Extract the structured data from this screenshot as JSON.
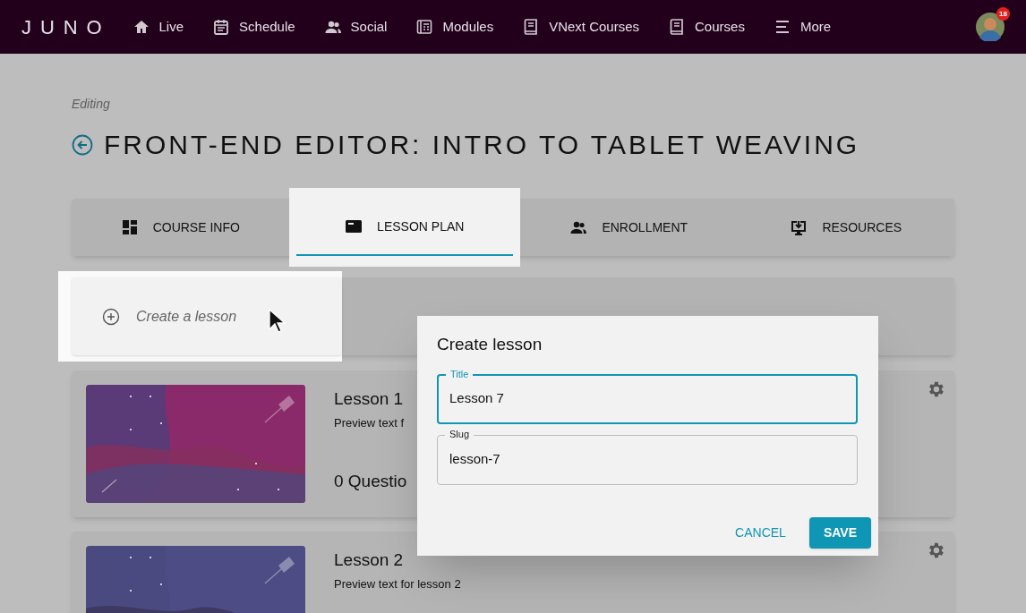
{
  "nav": {
    "logo": "JUNO",
    "items": [
      {
        "label": "Live"
      },
      {
        "label": "Schedule"
      },
      {
        "label": "Social"
      },
      {
        "label": "Modules"
      },
      {
        "label": "VNext Courses"
      },
      {
        "label": "Courses"
      },
      {
        "label": "More"
      }
    ],
    "notification_count": "18"
  },
  "header": {
    "subtitle": "Editing",
    "title": "FRONT-END EDITOR: INTRO TO TABLET WEAVING"
  },
  "tabs": [
    {
      "label": "COURSE INFO",
      "selected": false
    },
    {
      "label": "LESSON PLAN",
      "selected": true
    },
    {
      "label": "ENROLLMENT",
      "selected": false
    },
    {
      "label": "RESOURCES",
      "selected": false
    }
  ],
  "create_lesson": {
    "label": "Create a lesson"
  },
  "lessons": [
    {
      "title": "Lesson 1",
      "preview": "Preview text f",
      "questions": "0 Questio"
    },
    {
      "title": "Lesson 2",
      "preview": "Preview text for lesson 2"
    }
  ],
  "dialog": {
    "title": "Create lesson",
    "fields": [
      {
        "label": "Title",
        "value": "Lesson 7",
        "focused": true
      },
      {
        "label": "Slug",
        "value": "lesson-7",
        "focused": false
      }
    ],
    "buttons": [
      {
        "label": "CANCEL",
        "kind": "text"
      },
      {
        "label": "SAVE",
        "kind": "primary"
      }
    ]
  }
}
